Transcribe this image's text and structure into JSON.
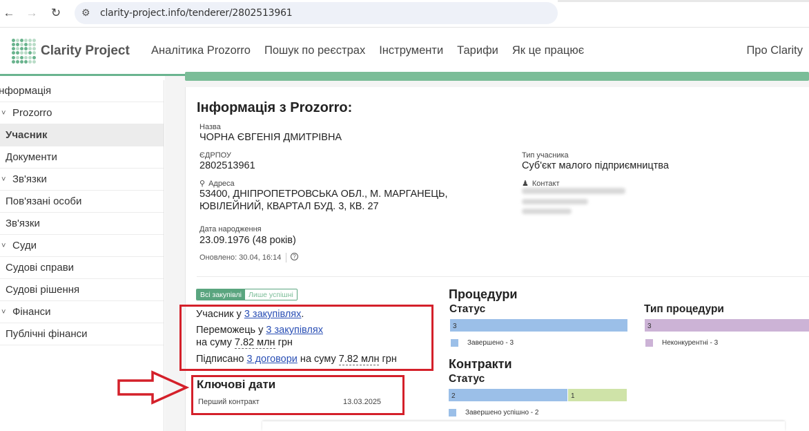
{
  "browser": {
    "url": "clarity-project.info/tenderer/2802513961",
    "back_icon": "←",
    "forward_icon": "→",
    "reload_icon": "↻"
  },
  "header": {
    "logo_text": "Clarity Project",
    "nav": [
      "Аналітика Prozorro",
      "Пошук по реєстрах",
      "Інструменти",
      "Тарифи",
      "Як це працює"
    ],
    "about": "Про Clarity"
  },
  "sidebar": {
    "items": [
      {
        "label": "Інформація",
        "kind": "top"
      },
      {
        "label": "Prozorro",
        "kind": "group"
      },
      {
        "label": "Учасник",
        "kind": "sub",
        "active": true
      },
      {
        "label": "Документи",
        "kind": "sub"
      },
      {
        "label": "Зв'язки",
        "kind": "group"
      },
      {
        "label": "Пов'язані особи",
        "kind": "sub"
      },
      {
        "label": "Зв'язки",
        "kind": "sub"
      },
      {
        "label": "Суди",
        "kind": "group"
      },
      {
        "label": "Судові справи",
        "kind": "sub"
      },
      {
        "label": "Судові рішення",
        "kind": "sub"
      },
      {
        "label": "Фінанси",
        "kind": "group"
      },
      {
        "label": "Публічні фінанси",
        "kind": "sub"
      }
    ]
  },
  "info": {
    "title": "Інформація з Prozorro:",
    "name_label": "Назва",
    "name": "ЧОРНА ЄВГЕНІЯ ДМИТРІВНА",
    "edrpou_label": "ЄДРПОУ",
    "edrpou": "2802513961",
    "type_label": "Тип учасника",
    "type": "Суб'єкт малого підприємництва",
    "address_label": "Адреса",
    "address_line1": "53400, ДНІПРОПЕТРОВСЬКА ОБЛ., М. МАРГАНЕЦЬ,",
    "address_line2": "ЮВІЛЕЙНИЙ, КВАРТАЛ БУД. 3, КВ. 27",
    "contact_label": "Контакт",
    "birth_label": "Дата народження",
    "birth": "23.09.1976 (48 років)",
    "updated": "Оновлено: 30.04, 16:14",
    "help_icon": "?"
  },
  "toggle": {
    "all": "Всі закупівлі",
    "success": "Лише успішні"
  },
  "stats": {
    "participant_prefix": "Учасник у ",
    "participant_link": "3 закупівлях",
    "participant_suffix": ".",
    "winner_prefix": "Переможець у ",
    "winner_link": "3 закупівлях",
    "winner_sum_prefix": "на суму ",
    "winner_sum": "7.82 млн",
    "winner_sum_suffix": " грн",
    "signed_prefix": "Підписано ",
    "signed_link": "3 договори",
    "signed_mid": " на суму ",
    "signed_sum": "7.82 млн",
    "signed_suffix": " грн"
  },
  "key_dates": {
    "title": "Ключові дати",
    "first_contract_label": "Перший контракт",
    "first_contract_date": "13.03.2025"
  },
  "procedures": {
    "title": "Процедури",
    "status_title": "Статус",
    "status_bar_value": "3",
    "status_legend": "Завершено - 3",
    "type_title": "Тип процедури",
    "type_bar_value": "3",
    "type_legend": "Неконкурентні - 3"
  },
  "contracts": {
    "title": "Контракти",
    "status_title": "Статус",
    "bar1_value": "2",
    "bar2_value": "1",
    "legend1": "Завершено успішно - 2"
  },
  "colors": {
    "accent_green": "#6ab48f",
    "highlight_red": "#d4202a",
    "bar_blue": "#9bbfe8",
    "bar_purple": "#ccb3d6",
    "bar_green": "#cfe3a8",
    "link_blue": "#2a4fb5"
  }
}
